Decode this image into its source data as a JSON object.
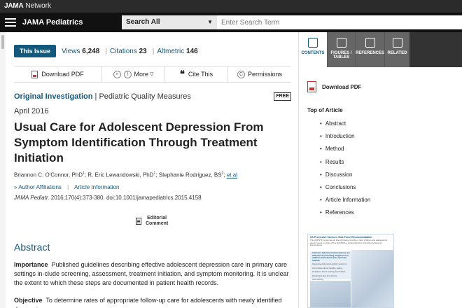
{
  "network": {
    "brand": "JAMA",
    "suffix": "Network"
  },
  "header": {
    "journal": "JAMA Pediatrics",
    "search_scope": "Search All",
    "search_placeholder": "Enter Search Term"
  },
  "meta": {
    "issue_button": "This Issue",
    "views_label": "Views",
    "views_value": "6,248",
    "citations_label": "Citations",
    "citations_value": "23",
    "altmetric_label": "Altmetric",
    "altmetric_value": "146"
  },
  "toolbar": {
    "download_pdf": "Download PDF",
    "more": "More",
    "cite_this": "Cite This",
    "permissions": "Permissions"
  },
  "article": {
    "type": "Original Investigation",
    "section": "Pediatric Quality Measures",
    "free_badge": "FREE",
    "date": "April 2016",
    "title": "Usual Care for Adolescent Depression From Symptom Identification Through Treatment Initiation",
    "authors": [
      {
        "name": "Briannon C. O'Connor, PhD",
        "sup": "1"
      },
      {
        "name": "R. Eric Lewandowski, PhD",
        "sup": "1"
      },
      {
        "name": "Stephanie Rodriguez, BS",
        "sup": "2"
      }
    ],
    "et_al": "et al",
    "author_affiliations": "Author Affiliations",
    "article_information": "Article Information",
    "citation_journal": "JAMA Pediatr.",
    "citation_rest": " 2016;170(4):373-380. doi:10.1001/jamapediatrics.2015.4158",
    "editorial_line1": "Editorial",
    "editorial_line2": "Comment"
  },
  "abstract": {
    "heading": "Abstract",
    "importance_label": "Importance",
    "importance_text": "Published guidelines describing effective adolescent depression care in primary care settings in-clude screening, assessment, treatment initiation, and symptom monitoring. It is unclear the extent to which these steps are documented in patient health records.",
    "objective_label": "Objective",
    "objective_text": "To determine rates of appropriate follow-up care for adolescents with newly identified depression"
  },
  "sidebar": {
    "tabs": [
      {
        "label": "CONTENTS",
        "icon": "list-icon"
      },
      {
        "label": "FIGURES / TABLES",
        "icon": "chart-icon"
      },
      {
        "label": "REFERENCES",
        "icon": "quote-icon"
      },
      {
        "label": "RELATED",
        "icon": "link-icon"
      }
    ],
    "download_pdf": "Download PDF",
    "toc_heading": "Top of Article",
    "toc": [
      "Abstract",
      "Introduction",
      "Method",
      "Results",
      "Discussion",
      "Conclusions",
      "Article Information",
      "References"
    ],
    "thumb_title": "US Preventive Services Task Force Recommendation",
    "thumb_sub": "The USPSTF recommends that clinicians provide or refer children and adolescents aged 6 years or older with a high BMI to comprehensive, intensive behavioral interventions.",
    "thumb_box": "Intensive behavioral interventions are effective at promoting weight loss in children and adolescents and may include",
    "thumb_items": [
      "Supervised physical activity sessions",
      "Information about healthy eating",
      "Guidance about reading food labels",
      "Monitoring diet and activity",
      "Goal setting"
    ]
  },
  "colors": {
    "accent": "#14587c",
    "header_bg": "#111111",
    "pdf_red": "#cc3333"
  }
}
